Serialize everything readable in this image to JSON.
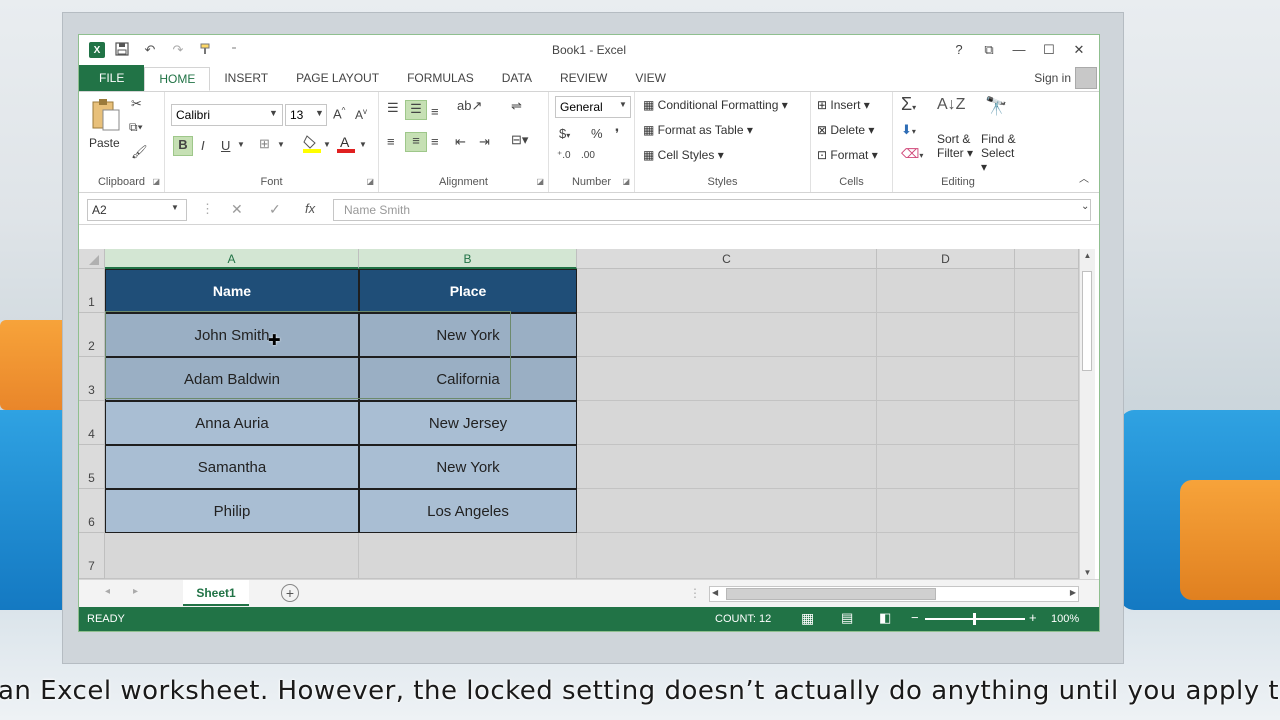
{
  "window": {
    "title": "Book1 - Excel",
    "controls": {
      "help": "?",
      "restore_ribbon": "⧉",
      "minimize": "—",
      "maximize": "☐",
      "close": "✕"
    }
  },
  "qat": {
    "logo": "X",
    "save": "💾",
    "undo": "↶",
    "redo": "↷",
    "paint": "🖌",
    "customize": "⁼"
  },
  "tabs": [
    "FILE",
    "HOME",
    "INSERT",
    "PAGE LAYOUT",
    "FORMULAS",
    "DATA",
    "REVIEW",
    "VIEW"
  ],
  "signin": "Sign in",
  "ribbon": {
    "clipboard": {
      "label": "Clipboard",
      "paste": "Paste"
    },
    "font": {
      "label": "Font",
      "name": "Calibri",
      "size": "13",
      "bold": "B",
      "italic": "I",
      "underline": "U",
      "grow": "A",
      "shrink": "A"
    },
    "alignment": {
      "label": "Alignment"
    },
    "number": {
      "label": "Number",
      "format": "General",
      "currency": "$",
      "percent": "%",
      "comma": "❜"
    },
    "styles": {
      "label": "Styles",
      "conditional": "Conditional Formatting",
      "format_table": "Format as Table",
      "cell_styles": "Cell Styles"
    },
    "cells": {
      "label": "Cells",
      "insert": "Insert",
      "delete": "Delete",
      "format": "Format"
    },
    "editing": {
      "label": "Editing",
      "sort": "Sort &",
      "filter": "Filter",
      "find": "Find &",
      "select": "Select"
    }
  },
  "formula_bar": {
    "name_box": "A2",
    "cancel": "✕",
    "enter": "✓",
    "fx": "fx",
    "value": "Name Smith"
  },
  "columns": [
    "A",
    "B",
    "C",
    "D"
  ],
  "rows": [
    "1",
    "2",
    "3",
    "4",
    "5",
    "6",
    "7"
  ],
  "table": {
    "headers": [
      "Name",
      "Place"
    ],
    "rows": [
      [
        "John Smith",
        "New York"
      ],
      [
        "Adam Baldwin",
        "California"
      ],
      [
        "Anna Auria",
        "New Jersey"
      ],
      [
        "Samantha",
        "New York"
      ],
      [
        "Philip",
        "Los Angeles"
      ]
    ]
  },
  "sheets": {
    "active": "Sheet1",
    "add": "+"
  },
  "status": {
    "mode": "READY",
    "count": "COUNT: 12",
    "zoom": "100%"
  },
  "caption": "an Excel worksheet. However, the locked setting doesn’t actually do anything until you apply th"
}
